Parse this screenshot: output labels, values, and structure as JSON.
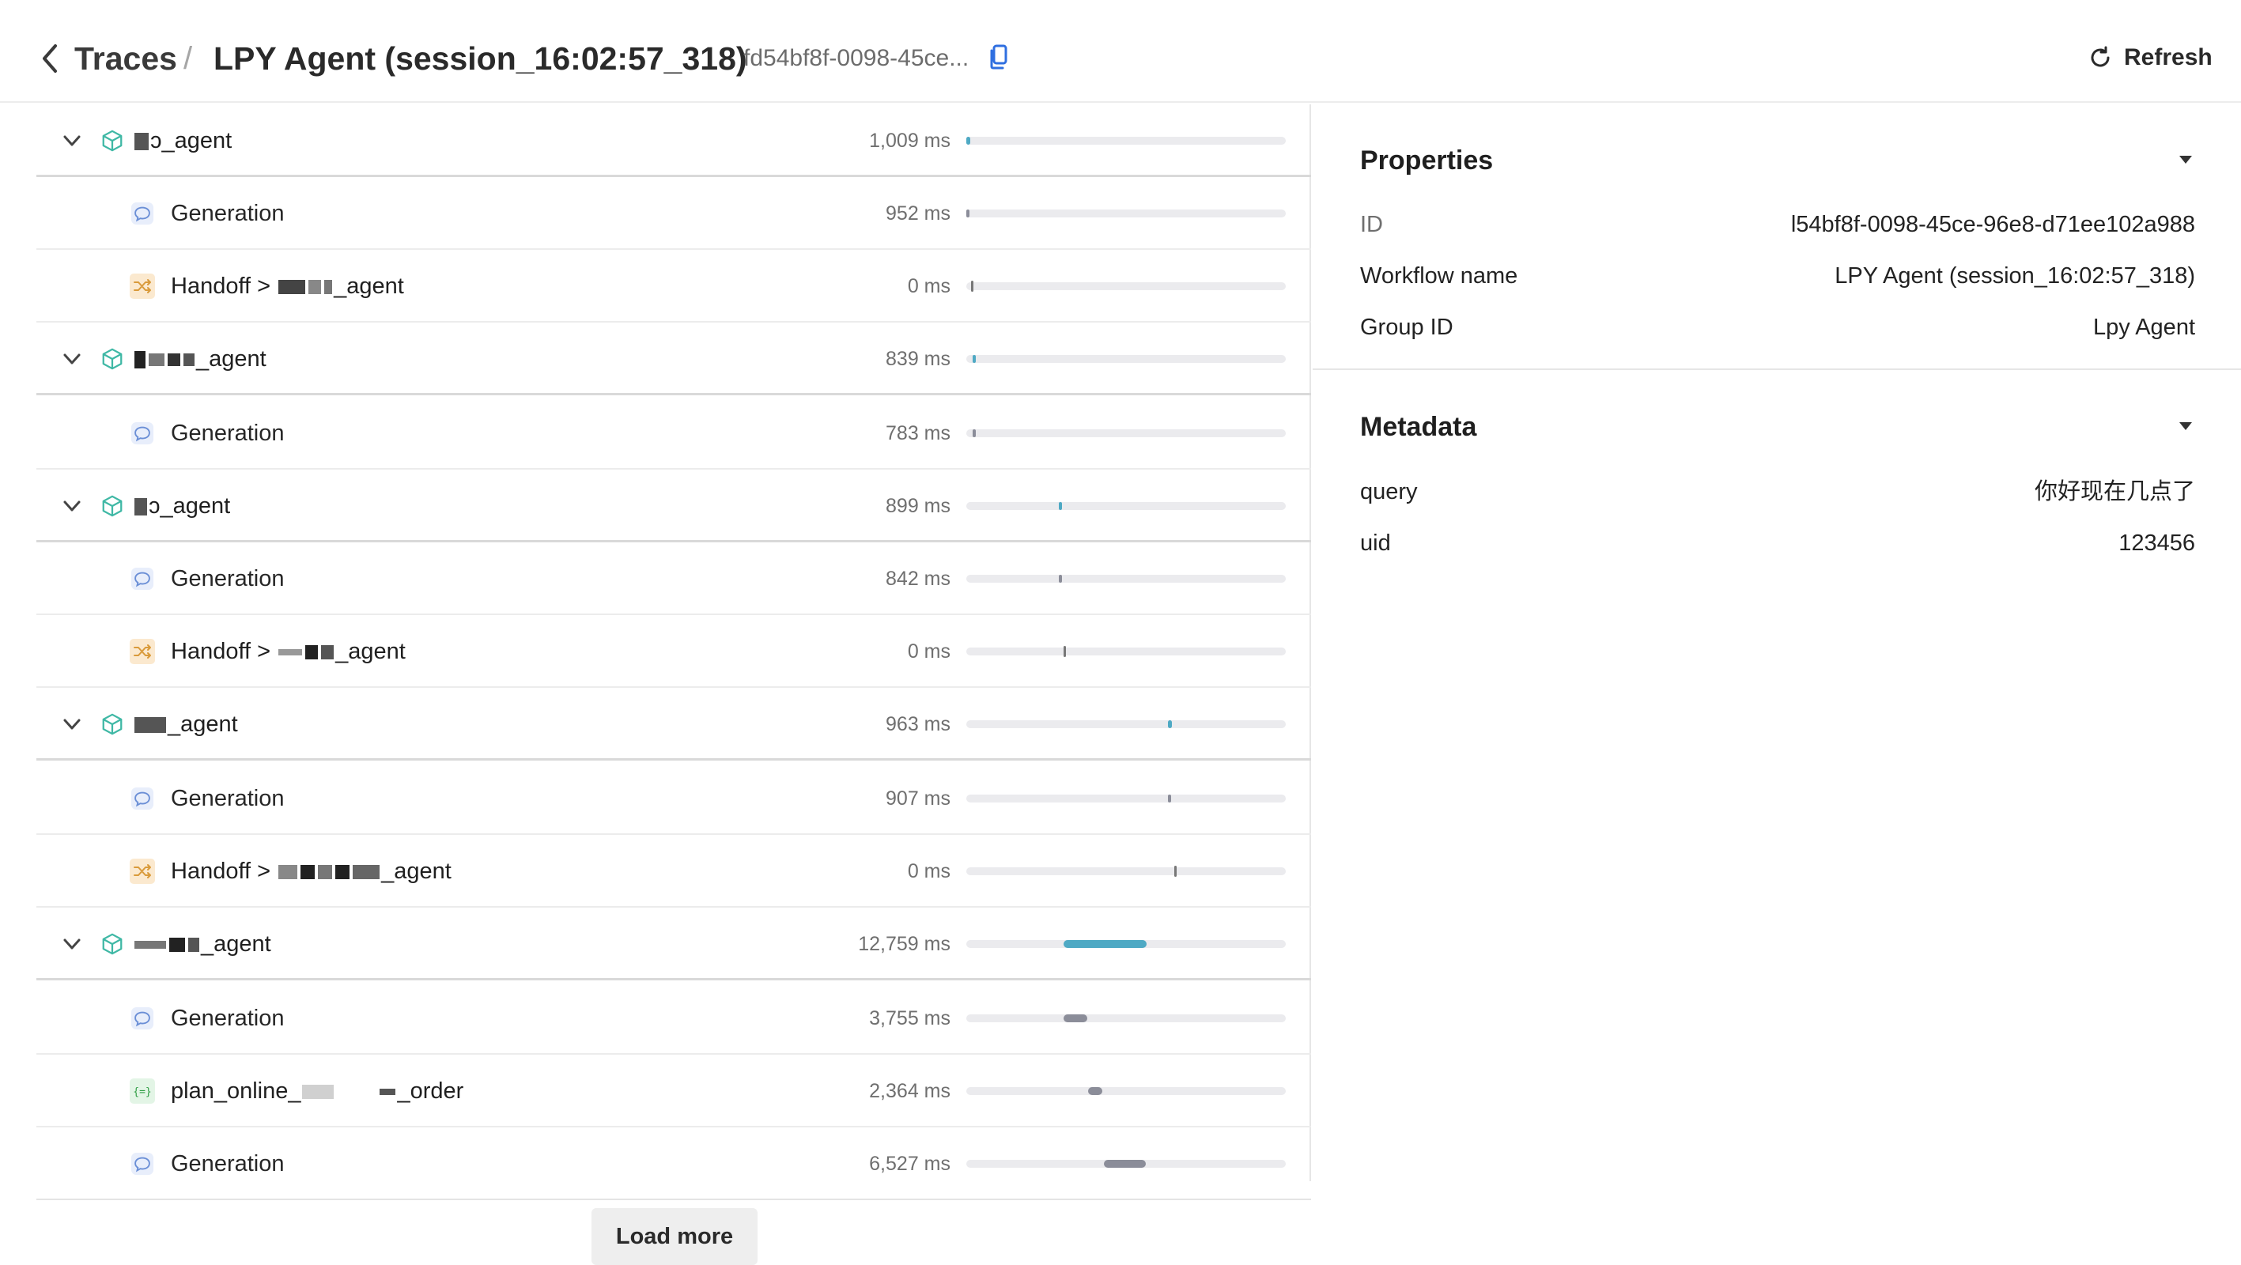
{
  "header": {
    "breadcrumb_root": "Traces",
    "separator": "/",
    "title": "LPY Agent (session_16:02:57_318)",
    "trace_id": "fd54bf8f-0098-45ce...",
    "refresh_label": "Refresh"
  },
  "spans": [
    {
      "kind": "agent",
      "name": "ɔ_agent",
      "duration": "1,009 ms",
      "bar": [
        0.0,
        0.012
      ]
    },
    {
      "kind": "generation",
      "name": "Generation",
      "duration": "952 ms",
      "bar": [
        0.0,
        0.011
      ]
    },
    {
      "kind": "handoff",
      "name": "Handoff > ",
      "suffix": "_agent",
      "duration": "0 ms",
      "bar": [
        0.015,
        0.009
      ]
    },
    {
      "kind": "agent",
      "name": "_agent",
      "duration": "839 ms",
      "bar": [
        0.02,
        0.01
      ]
    },
    {
      "kind": "generation",
      "name": "Generation",
      "duration": "783 ms",
      "bar": [
        0.02,
        0.009
      ]
    },
    {
      "kind": "agent",
      "name": "ɔ_agent",
      "duration": "899 ms",
      "bar": [
        0.29,
        0.011
      ]
    },
    {
      "kind": "generation",
      "name": "Generation",
      "duration": "842 ms",
      "bar": [
        0.29,
        0.01
      ]
    },
    {
      "kind": "handoff",
      "name": "Handoff > ",
      "suffix": "_agent",
      "duration": "0 ms",
      "bar": [
        0.305,
        0.008
      ]
    },
    {
      "kind": "agent",
      "name": "_agent",
      "duration": "963 ms",
      "bar": [
        0.63,
        0.012
      ]
    },
    {
      "kind": "generation",
      "name": "Generation",
      "duration": "907 ms",
      "bar": [
        0.63,
        0.011
      ]
    },
    {
      "kind": "handoff",
      "name": "Handoff > ",
      "suffix": "_agent",
      "duration": "0 ms",
      "bar": [
        0.65,
        0.008
      ]
    },
    {
      "kind": "agent",
      "name": "_agent",
      "duration": "12,759 ms",
      "bar": [
        0.305,
        0.26
      ]
    },
    {
      "kind": "generation",
      "name": "Generation",
      "duration": "3,755 ms",
      "bar": [
        0.305,
        0.075
      ]
    },
    {
      "kind": "function",
      "name": "plan_online_",
      "suffix": "_order",
      "duration": "2,364 ms",
      "bar": [
        0.38,
        0.045
      ]
    },
    {
      "kind": "generation",
      "name": "Generation",
      "duration": "6,527 ms",
      "bar": [
        0.43,
        0.13
      ]
    }
  ],
  "load_more_label": "Load more",
  "properties": {
    "title": "Properties",
    "rows": [
      {
        "label": "ID",
        "value": "l54bf8f-0098-45ce-96e8-d71ee102a988"
      },
      {
        "label": "Workflow name",
        "value": "LPY Agent (session_16:02:57_318)"
      },
      {
        "label": "Group ID",
        "value": "Lpy Agent"
      }
    ]
  },
  "metadata": {
    "title": "Metadata",
    "rows": [
      {
        "label": "query",
        "value": "你好现在几点了"
      },
      {
        "label": "uid",
        "value": "123456"
      }
    ]
  },
  "colors": {
    "agent_bar": "#4ea9c4",
    "sub_bar": "#8b8d99",
    "track": "#ebebee",
    "agent_icon": "#3fb8a5",
    "generation_icon": "#6b8fd6",
    "handoff_icon_bg": "#fbe9cf",
    "function_icon": "#2f9e44"
  }
}
